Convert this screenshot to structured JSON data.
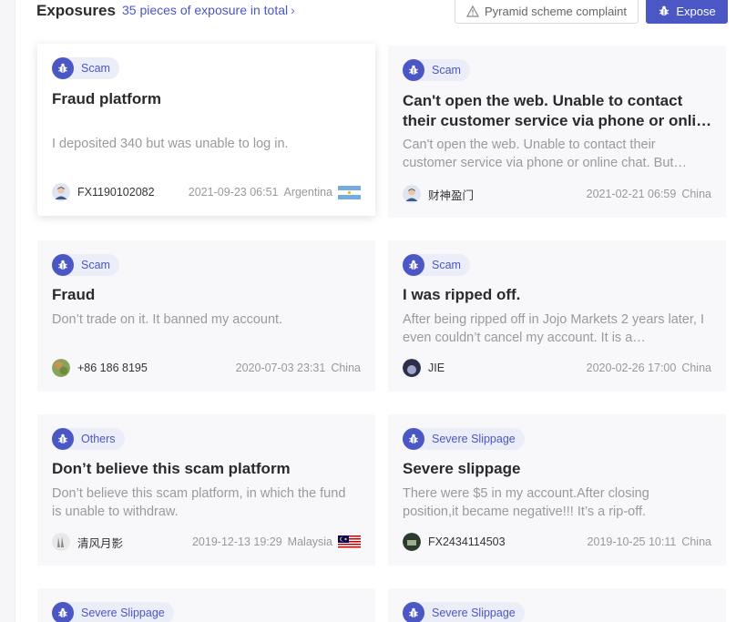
{
  "header": {
    "title": "Exposures",
    "total": "35 pieces of exposure in total",
    "pyramid_button": "Pyramid scheme complaint",
    "expose_button": "Expose"
  },
  "colors": {
    "accent": "#4a57c4",
    "tag_bg": "#ebedf8",
    "card_bg": "#f8f8fa"
  },
  "cards": [
    {
      "tag": "Scam",
      "title": "Fraud platform",
      "desc": "I deposited 340 but was unable to log in.",
      "user": "FX1190102082",
      "date": "2021-09-23 06:51",
      "country": "Argentina",
      "flag": "argentina-flag"
    },
    {
      "tag": "Scam",
      "title": "Can't open the web. Unable to contact their customer service via phone or online chat…",
      "desc": "Can't open the web. Unable to contact their customer service via phone or online chat. But…",
      "user": "财神盈门",
      "date": "2021-02-21 06:59",
      "country": "China",
      "flag": ""
    },
    {
      "tag": "Scam",
      "title": "Fraud",
      "desc": "Don’t trade on it. It banned my account.",
      "user": "+86 186 8195",
      "date": "2020-07-03 23:31",
      "country": "China",
      "flag": ""
    },
    {
      "tag": "Scam",
      "title": "I was ripped off.",
      "desc": "After being ripped off in Jojo Markets 2 years later, I even couldn’t cancel my account. It is a…",
      "user": "JIE",
      "date": "2020-02-26 17:00",
      "country": "China",
      "flag": ""
    },
    {
      "tag": "Others",
      "title": "Don’t believe this scam platform",
      "desc": "Don’t believe this scam platform, in which the fund is unable to withdraw.",
      "user": "清风月影",
      "date": "2019-12-13 19:29",
      "country": "Malaysia",
      "flag": "malaysia-flag"
    },
    {
      "tag": "Severe Slippage",
      "title": "Severe slippage",
      "desc": "There were $5 in my account.After closing position,it became negative!!! It’s a rip-off.",
      "user": "FX2434114503",
      "date": "2019-10-25 10:11",
      "country": "China",
      "flag": ""
    },
    {
      "tag": "Severe Slippage"
    },
    {
      "tag": "Severe Slippage"
    }
  ]
}
